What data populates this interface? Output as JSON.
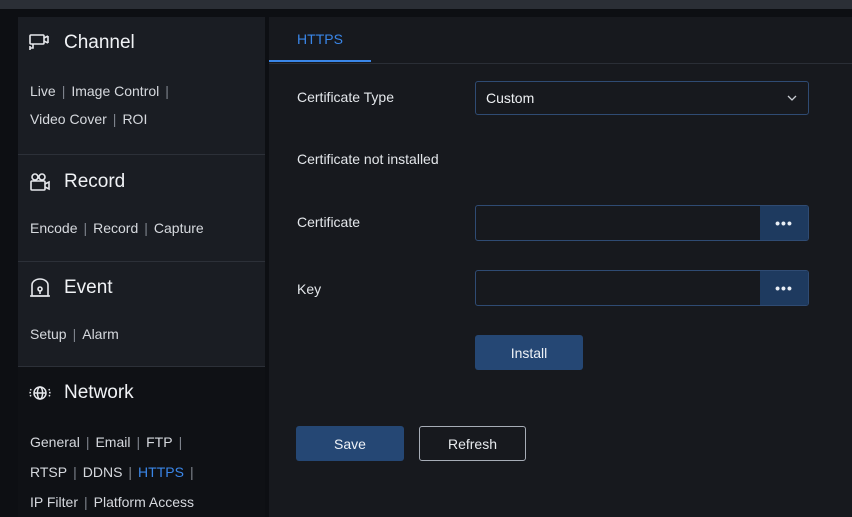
{
  "sidebar": {
    "channel": {
      "title": "Channel",
      "links": [
        "Live",
        "Image Control",
        "Video Cover",
        "ROI"
      ]
    },
    "record": {
      "title": "Record",
      "links": [
        "Encode",
        "Record",
        "Capture"
      ]
    },
    "event": {
      "title": "Event",
      "links": [
        "Setup",
        "Alarm"
      ]
    },
    "network": {
      "title": "Network",
      "links": [
        "General",
        "Email",
        "FTP",
        "RTSP",
        "DDNS",
        "HTTPS",
        "IP Filter",
        "Platform Access"
      ],
      "active_link": "HTTPS"
    },
    "separator": "|"
  },
  "main": {
    "tab": "HTTPS",
    "certificate_type_label": "Certificate Type",
    "certificate_type_value": "Custom",
    "status_text": "Certificate not installed",
    "certificate_label": "Certificate",
    "certificate_value": "",
    "key_label": "Key",
    "key_value": "",
    "browse_label": "•••",
    "install_label": "Install",
    "save_label": "Save",
    "refresh_label": "Refresh"
  },
  "colors": {
    "accent": "#3a86e8",
    "primary_button": "#254774",
    "background": "#17191e",
    "sidebar": "#1a1d23"
  }
}
